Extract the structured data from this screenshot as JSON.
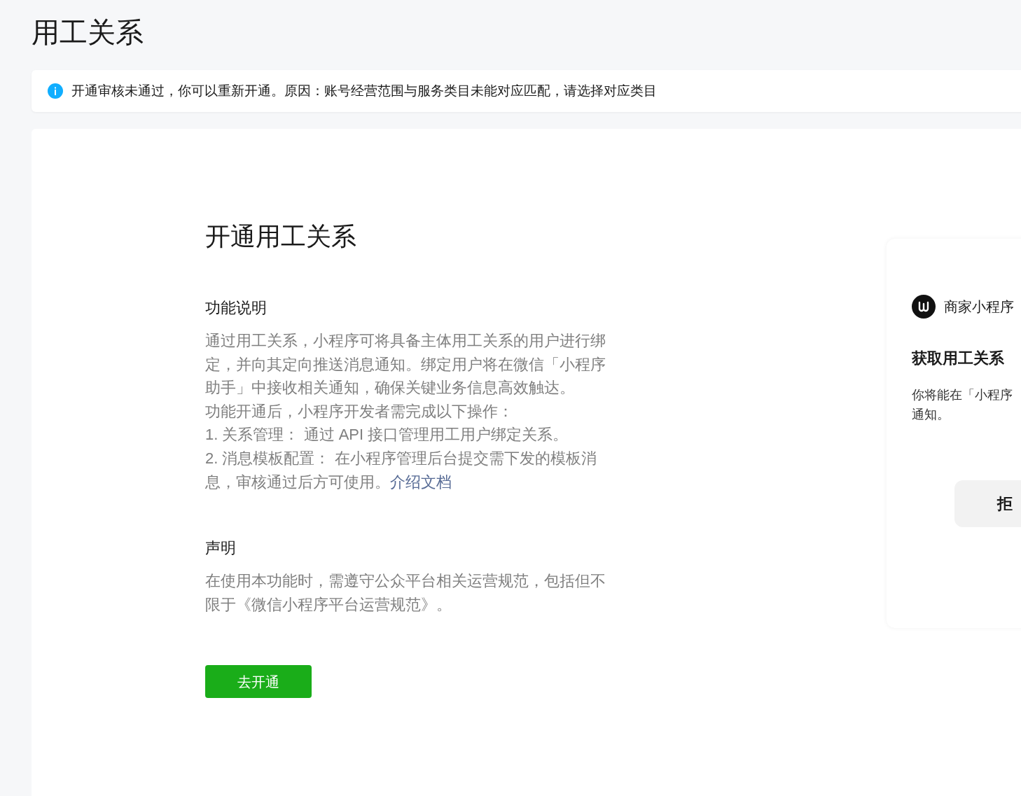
{
  "page_title": "用工关系",
  "notice": {
    "text": "开通审核未通过，你可以重新开通。原因：账号经营范围与服务类目未能对应匹配，请选择对应类目"
  },
  "main": {
    "title": "开通用工关系",
    "sections": [
      {
        "heading": "功能说明",
        "paragraphs": [
          {
            "text": "通过用工关系，小程序可将具备主体用工关系的用户进行绑定，并向其定向推送消息通知。绑定用户将在微信「小程序助手」中接收相关通知，确保关键业务信息高效触达。"
          },
          {
            "text": "功能开通后，小程序开发者需完成以下操作："
          },
          {
            "text": "1. 关系管理： 通过 API 接口管理用工用户绑定关系。"
          },
          {
            "text": "2. 消息模板配置： 在小程序管理后台提交需下发的模板消息，审核通过后方可使用。",
            "link": "介绍文档"
          }
        ]
      },
      {
        "heading": "声明",
        "paragraphs": [
          {
            "text": "在使用本功能时，需遵守公众平台相关运营规范，包括但不限于《微信小程序平台运营规范》。"
          }
        ]
      }
    ],
    "button": "去开通"
  },
  "preview": {
    "app_name": "商家小程序",
    "heading": "获取用工关系",
    "description_lines": [
      "你将能在「小程序",
      "通知。"
    ],
    "button": "拒"
  }
}
